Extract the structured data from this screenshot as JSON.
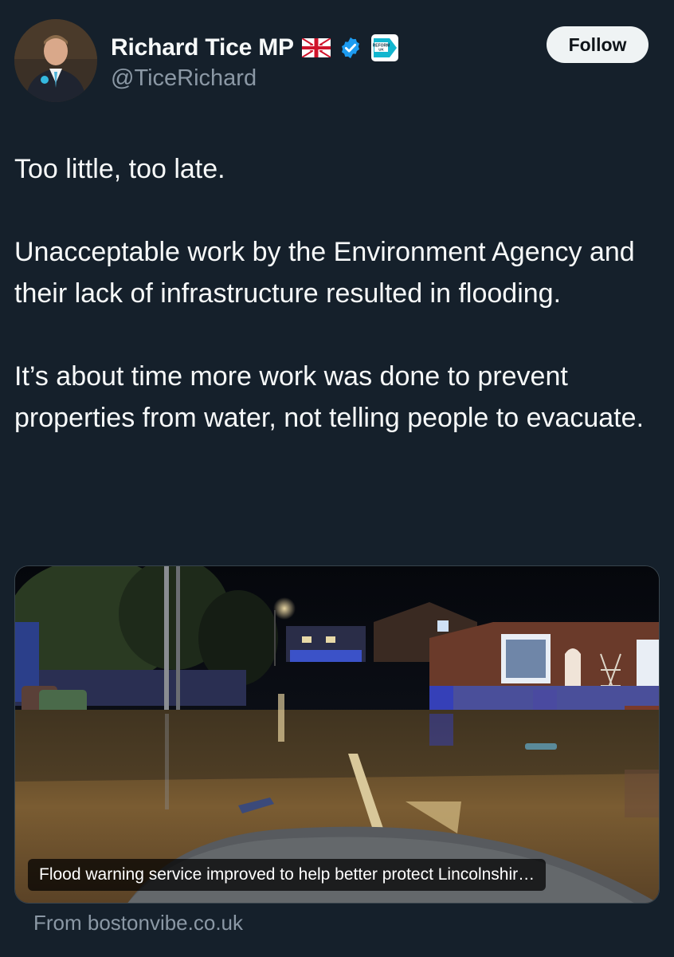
{
  "author": {
    "display_name": "Richard Tice MP",
    "handle": "@TiceRichard",
    "flag_icon": "union-jack-flag-icon",
    "verified_icon": "verified-badge-icon",
    "affiliation_icon": "reform-uk-badge-icon",
    "affiliation_text": "REFORM UK",
    "verified_color": "#1d9bf0",
    "affiliation_color": "#12b6cf"
  },
  "follow_button": {
    "label": "Follow"
  },
  "tweet": {
    "paragraphs": [
      "Too little, too late.",
      "Unacceptable work by the Environment Agency and their lack of infrastructure resulted in flooding.",
      "It’s about time more work was done to prevent properties from water, not telling people to evacuate."
    ]
  },
  "link_card": {
    "image_description_icon": "flooded-street-photo",
    "caption": "Flood warning service improved to help better protect Lincolnshir…",
    "source": "From bostonvibe.co.uk"
  },
  "colors": {
    "background": "#15202b",
    "text_primary": "#f7f9f9",
    "text_secondary": "#8b98a5",
    "button_bg": "#eff3f4"
  }
}
